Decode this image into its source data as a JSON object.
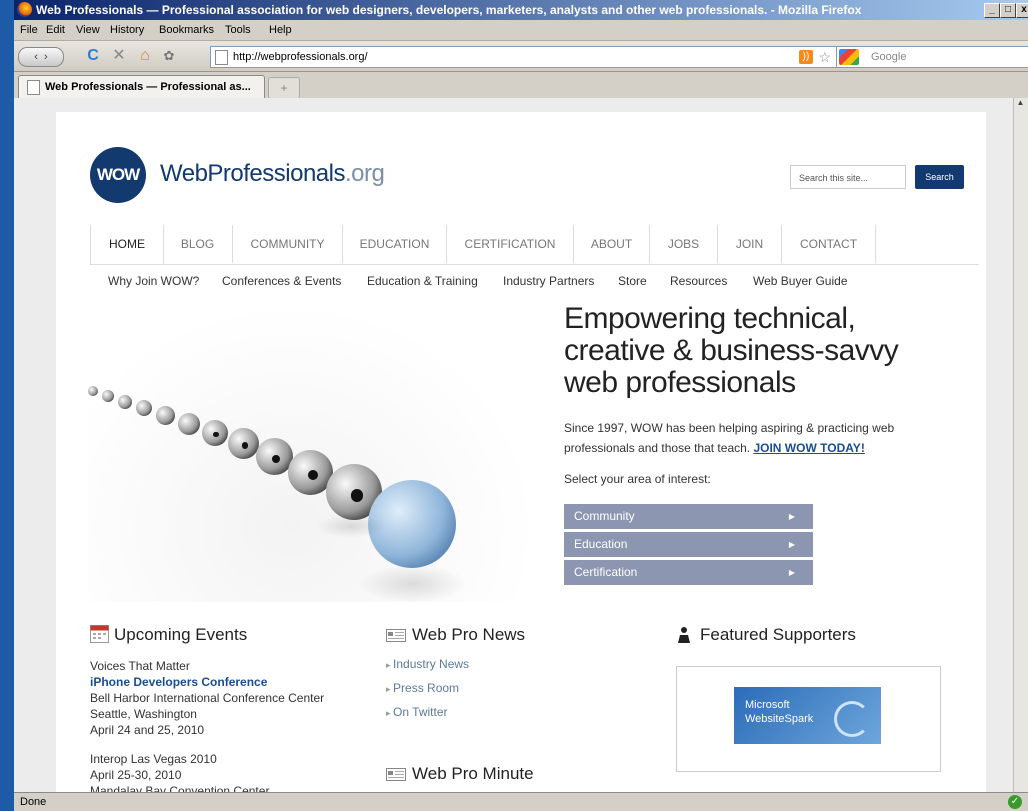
{
  "window": {
    "title": "Web Professionals — Professional association for web designers, developers, marketers, analysts and other web professionals. - Mozilla Firefox",
    "controls": [
      "_",
      "□",
      "x"
    ]
  },
  "menu": {
    "items": [
      {
        "label": "File",
        "key": "F"
      },
      {
        "label": "Edit",
        "key": "E"
      },
      {
        "label": "View",
        "key": "V"
      },
      {
        "label": "History",
        "key": "s"
      },
      {
        "label": "Bookmarks",
        "key": "B"
      },
      {
        "label": "Tools",
        "key": "T"
      },
      {
        "label": "Help",
        "key": "H"
      }
    ]
  },
  "toolbar": {
    "url": "http://webprofessionals.org/",
    "search_placeholder": "Google"
  },
  "tabs": {
    "active": "Web Professionals — Professional as...",
    "new_tab_glyph": "+"
  },
  "status": {
    "text": "Done"
  },
  "site": {
    "logo_badge": "WOW",
    "logo_name": "WebProfessionals",
    "logo_tld": ".org",
    "search_placeholder": "Search this site...",
    "search_button": "Search",
    "nav": [
      "HOME",
      "BLOG",
      "COMMUNITY",
      "EDUCATION",
      "CERTIFICATION",
      "ABOUT",
      "JOBS",
      "JOIN",
      "CONTACT"
    ],
    "subnav": [
      "Why Join WOW?",
      "Conferences & Events",
      "Education & Training",
      "Industry Partners",
      "Store",
      "Resources",
      "Web Buyer Guide"
    ],
    "hero": {
      "title": "Empowering technical, creative & business-savvy web professionals",
      "text": "Since 1997, WOW has been helping aspiring & practicing web professionals and those that teach.",
      "cta": "JOIN WOW TODAY!",
      "select_label": "Select your area of interest:",
      "areas": [
        "Community",
        "Education",
        "Certification"
      ]
    },
    "events": {
      "heading": "Upcoming Events",
      "items": [
        {
          "line1": "Voices That Matter",
          "title": "iPhone Developers Conference",
          "venue": "Bell Harbor International Conference Center",
          "city": "Seattle, Washington",
          "date": "April 24 and 25, 2010"
        },
        {
          "line1": "Interop Las Vegas 2010",
          "date": "April 25-30, 2010",
          "venue": "Mandalay Bay Convention Center"
        }
      ]
    },
    "news": {
      "heading": "Web Pro News",
      "links": [
        "Industry News",
        "Press Room",
        "On Twitter"
      ],
      "minute_heading": "Web Pro Minute"
    },
    "supporters": {
      "heading": "Featured Supporters",
      "logo_line1": "Microsoft",
      "logo_line2": "WebsiteSpark"
    }
  }
}
